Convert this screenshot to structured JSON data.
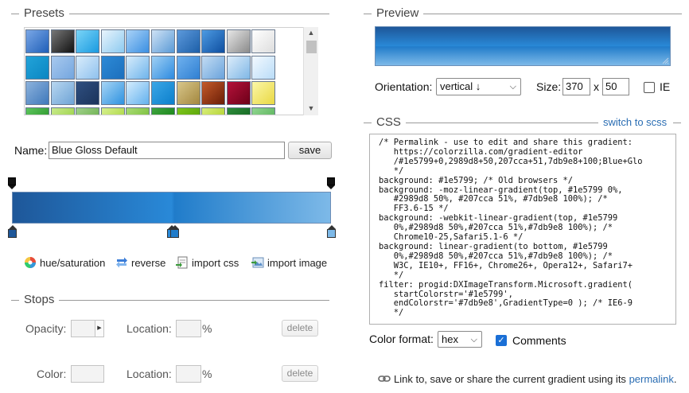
{
  "presets": {
    "title": "Presets",
    "swatches": [
      {
        "colors": [
          "#7aa7e6",
          "#1f5fb8"
        ]
      },
      {
        "colors": [
          "#777777",
          "#111111"
        ]
      },
      {
        "colors": [
          "#7ad4f7",
          "#1a9ae0"
        ]
      },
      {
        "colors": [
          "#e9f4fc",
          "#8ccaf0"
        ]
      },
      {
        "colors": [
          "#a9d2f7",
          "#3b8fe2"
        ]
      },
      {
        "colors": [
          "#cfe2f5",
          "#5a9ad6"
        ]
      },
      {
        "colors": [
          "#5c99db",
          "#1d5fa8"
        ]
      },
      {
        "colors": [
          "#4d9be2",
          "#0e4ea0"
        ]
      },
      {
        "colors": [
          "#e6e6e6",
          "#8a8a8a"
        ]
      },
      {
        "colors": [
          "#ffffff",
          "#dddddd"
        ]
      },
      {
        "colors": [
          "#22a3d9",
          "#0b86c2"
        ]
      },
      {
        "colors": [
          "#a8c9ee",
          "#74a6df"
        ]
      },
      {
        "colors": [
          "#d9ecfb",
          "#8ec1ee"
        ]
      },
      {
        "colors": [
          "#2d8ad6",
          "#1c6fbd"
        ]
      },
      {
        "colors": [
          "#d7ecfb",
          "#6eb4ec"
        ]
      },
      {
        "colors": [
          "#9fd0f4",
          "#2e8ae0"
        ]
      },
      {
        "colors": [
          "#6fb1ee",
          "#2f7fd2"
        ]
      },
      {
        "colors": [
          "#c3dcf3",
          "#6aa3dc"
        ]
      },
      {
        "colors": [
          "#dcecfa",
          "#7fb7e6"
        ]
      },
      {
        "colors": [
          "#f3f9ff",
          "#b9dcf7"
        ]
      },
      {
        "colors": [
          "#8cb2dc",
          "#3f78bb"
        ]
      },
      {
        "colors": [
          "#b7d6f0",
          "#6fa4d6"
        ]
      },
      {
        "colors": [
          "#2f4f80",
          "#1b345b"
        ]
      },
      {
        "colors": [
          "#a6d4f5",
          "#2e92e0"
        ]
      },
      {
        "colors": [
          "#d4ecfd",
          "#63b1ee"
        ]
      },
      {
        "colors": [
          "#3aa6e6",
          "#0c7fcc"
        ]
      },
      {
        "colors": [
          "#d8c68b",
          "#a3873e"
        ]
      },
      {
        "colors": [
          "#c45a2a",
          "#6a1d06"
        ]
      },
      {
        "colors": [
          "#b4123a",
          "#6d0019"
        ]
      },
      {
        "colors": [
          "#fbf7a8",
          "#e9d843"
        ]
      },
      {
        "colors": [
          "#5cc45c",
          "#1f8a1f"
        ]
      },
      {
        "colors": [
          "#c8ea8a",
          "#8fcb36"
        ]
      },
      {
        "colors": [
          "#9fd089",
          "#5ea73e"
        ]
      },
      {
        "colors": [
          "#d6f08e",
          "#a0cf2d"
        ]
      },
      {
        "colors": [
          "#a8db73",
          "#6cb52b"
        ]
      },
      {
        "colors": [
          "#3ea43e",
          "#0e7a0e"
        ]
      },
      {
        "colors": [
          "#7cc41a",
          "#4f9a05"
        ]
      },
      {
        "colors": [
          "#d8ee7a",
          "#a6c818"
        ]
      },
      {
        "colors": [
          "#2c8a3a",
          "#0f5e1c"
        ]
      },
      {
        "colors": [
          "#8fd58f",
          "#4daa4d"
        ]
      }
    ]
  },
  "name": {
    "label": "Name:",
    "value": "Blue Gloss Default",
    "save_label": "save"
  },
  "gradient": {
    "css": "linear-gradient(to right, #1e5799 0%, #2989d8 50%, #207cca 51%, #7db9e8 100%)",
    "opacity_stops": [
      0,
      100
    ],
    "color_stops": [
      {
        "pos": 0,
        "color": "#1e5799"
      },
      {
        "pos": 50,
        "color": "#2989d8"
      },
      {
        "pos": 51,
        "color": "#207cca"
      },
      {
        "pos": 100,
        "color": "#7db9e8"
      }
    ]
  },
  "tools": {
    "hue": "hue/saturation",
    "reverse": "reverse",
    "import_css": "import css",
    "import_image": "import image"
  },
  "stops": {
    "title": "Stops",
    "opacity_label": "Opacity:",
    "location_label": "Location:",
    "percent": "%",
    "delete_label": "delete",
    "color_label": "Color:"
  },
  "preview": {
    "title": "Preview",
    "orientation_label": "Orientation:",
    "orientation_value": "vertical ↓",
    "size_label": "Size:",
    "width": "370",
    "x_label": "x",
    "height": "50",
    "ie_label": "IE"
  },
  "css": {
    "title": "CSS",
    "switch_label": "switch to scss",
    "lines": [
      "/* Permalink - use to edit and share this gradient:",
      "   https://colorzilla.com/gradient-editor",
      "   /#1e5799+0,2989d8+50,207cca+51,7db9e8+100;Blue+Glo",
      "   */",
      "background: #1e5799; /* Old browsers */",
      "background: -moz-linear-gradient(top, #1e5799 0%,",
      "   #2989d8 50%, #207cca 51%, #7db9e8 100%); /*",
      "   FF3.6-15 */",
      "background: -webkit-linear-gradient(top, #1e5799",
      "   0%,#2989d8 50%,#207cca 51%,#7db9e8 100%); /*",
      "   Chrome10-25,Safari5.1-6 */",
      "background: linear-gradient(to bottom, #1e5799",
      "   0%,#2989d8 50%,#207cca 51%,#7db9e8 100%); /*",
      "   W3C, IE10+, FF16+, Chrome26+, Opera12+, Safari7+",
      "   */",
      "filter: progid:DXImageTransform.Microsoft.gradient(",
      "   startColorstr='#1e5799',",
      "   endColorstr='#7db9e8',GradientType=0 ); /* IE6-9",
      "   */"
    ],
    "format_label": "Color format:",
    "format_value": "hex",
    "comments_label": "Comments",
    "comments_checked": true
  },
  "footer": {
    "text": "Link to, save or share the current gradient using its",
    "link_label": "permalink",
    "period": "."
  }
}
